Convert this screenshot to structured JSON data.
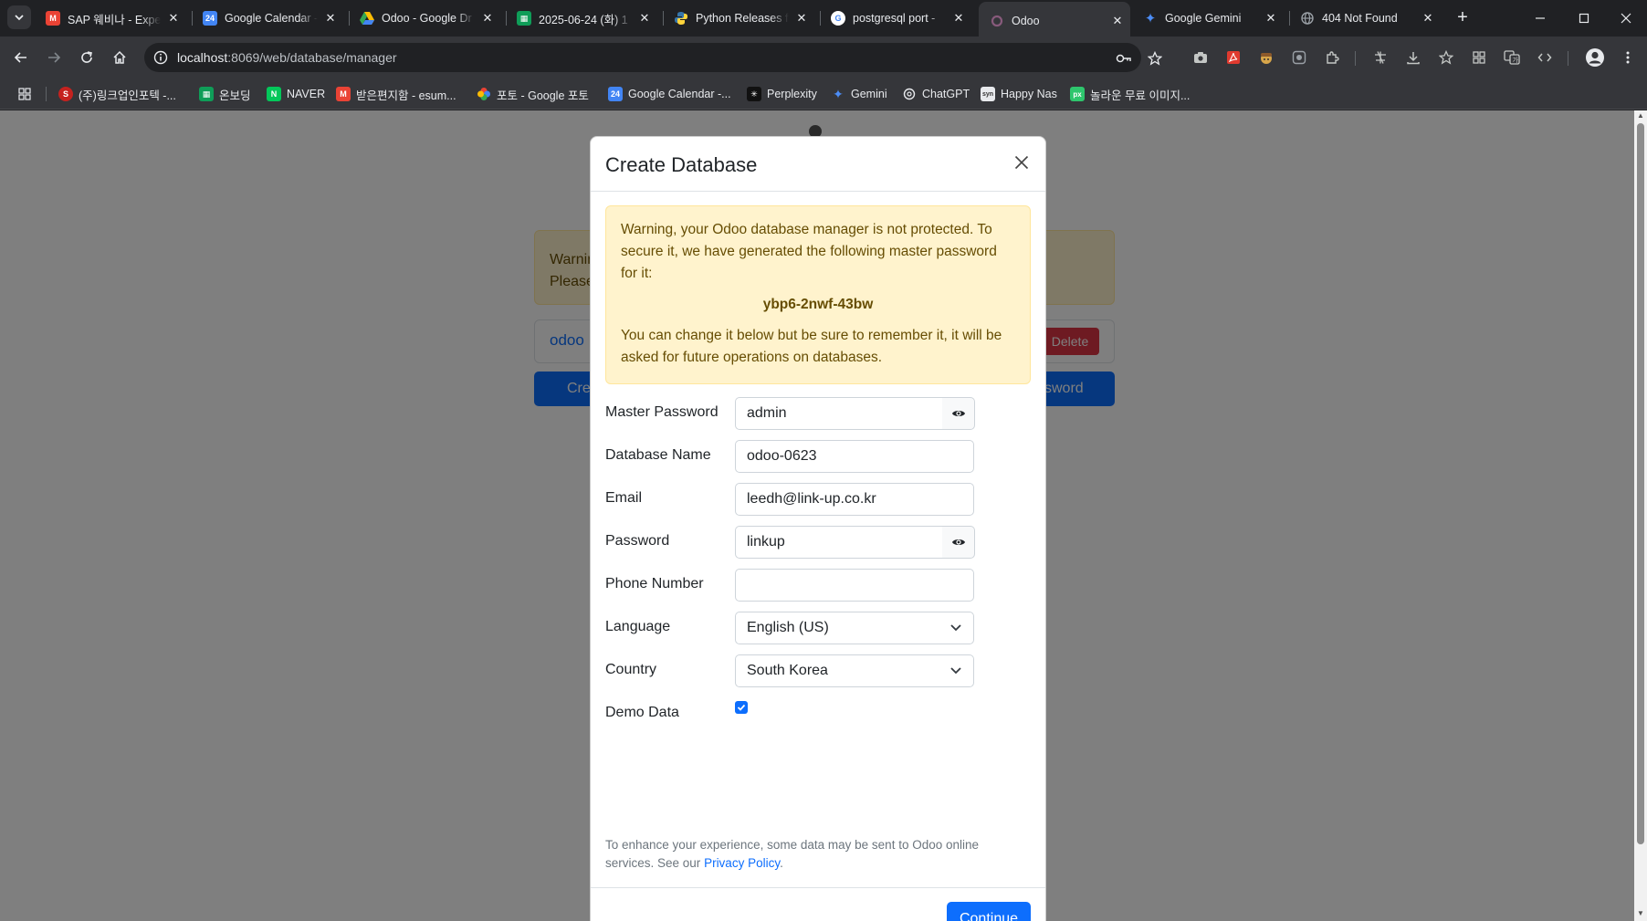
{
  "browser": {
    "tabs": [
      {
        "title": "SAP 웨비나 - Expe",
        "favicon": "gmail-icon",
        "color": "#ea4335",
        "active": false
      },
      {
        "title": "Google Calendar -",
        "favicon": "calendar-icon",
        "color": "#4285f4",
        "active": false
      },
      {
        "title": "Odoo - Google Dr",
        "favicon": "drive-icon",
        "color": "#34a853",
        "active": false
      },
      {
        "title": "2025-06-24 (화) 1",
        "favicon": "sheets-icon",
        "color": "#0f9d58",
        "active": false
      },
      {
        "title": "Python Releases fo",
        "favicon": "python-icon",
        "color": "#3776ab",
        "active": false
      },
      {
        "title": "postgresql port -",
        "favicon": "google-icon",
        "color": "#ffffff",
        "active": false
      },
      {
        "title": "Odoo",
        "favicon": "odoo-icon",
        "color": "#875a7b",
        "active": true
      },
      {
        "title": "Google Gemini",
        "favicon": "gemini-icon",
        "color": "#4c8df6",
        "active": false
      },
      {
        "title": "404 Not Found",
        "favicon": "globe-icon",
        "color": "#9aa0a6",
        "active": false
      }
    ],
    "url_host": "localhost",
    "url_rest": ":8069/web/database/manager",
    "bookmarks": [
      {
        "label": "(주)링크업인포텍 -...",
        "favicon": "linkup-icon",
        "color": "#c5221f"
      },
      {
        "label": "온보딩",
        "favicon": "sheets-icon",
        "color": "#0f9d58"
      },
      {
        "label": "NAVER",
        "favicon": "naver-icon",
        "color": "#03c75a"
      },
      {
        "label": "받은편지함 - esum...",
        "favicon": "gmail-icon",
        "color": "#ea4335"
      },
      {
        "label": "포토 - Google 포토",
        "favicon": "photos-icon",
        "color": "#fbbc04"
      },
      {
        "label": "Google Calendar -...",
        "favicon": "calendar-icon",
        "color": "#4285f4"
      },
      {
        "label": "Perplexity",
        "favicon": "perplexity-icon",
        "color": "#20808d"
      },
      {
        "label": "Gemini",
        "favicon": "gemini-icon",
        "color": "#4c8df6"
      },
      {
        "label": "ChatGPT",
        "favicon": "chatgpt-icon",
        "color": "#ffffff"
      },
      {
        "label": "Happy Nas",
        "favicon": "synology-icon",
        "color": "#e8eaed"
      },
      {
        "label": "놀라운 무료 이미지...",
        "favicon": "pixabay-icon",
        "color": "#2ec66d"
      }
    ]
  },
  "background_page": {
    "alert_line1": "Warnin",
    "alert_line2": "Please",
    "db_name": "odoo",
    "delete_label": "Delete",
    "create_label": "Cre",
    "password_label": "ssword"
  },
  "modal": {
    "title": "Create Database",
    "warning": {
      "intro": "Warning, your Odoo database manager is not protected. To secure it, we have generated the following master password for it:",
      "generated_password": "ybp6-2nwf-43bw",
      "outro": "You can change it below but be sure to remember it, it will be asked for future operations on databases."
    },
    "fields": {
      "master_password": {
        "label": "Master Password",
        "value": "admin"
      },
      "database_name": {
        "label": "Database Name",
        "value": "odoo-0623"
      },
      "email": {
        "label": "Email",
        "value": "leedh@link-up.co.kr"
      },
      "password": {
        "label": "Password",
        "value": "linkup"
      },
      "phone": {
        "label": "Phone Number",
        "value": ""
      },
      "language": {
        "label": "Language",
        "value": "English (US)"
      },
      "country": {
        "label": "Country",
        "value": "South Korea"
      },
      "demo_data": {
        "label": "Demo Data",
        "checked": true
      }
    },
    "privacy_text": "To enhance your experience, some data may be sent to Odoo online services. See our",
    "privacy_link": "Privacy Policy",
    "privacy_end": ".",
    "continue_label": "Continue"
  },
  "colors": {
    "primary": "#0d6efd",
    "danger": "#dc3545",
    "warning_bg": "#fff3cd",
    "warning_text": "#664d03"
  }
}
